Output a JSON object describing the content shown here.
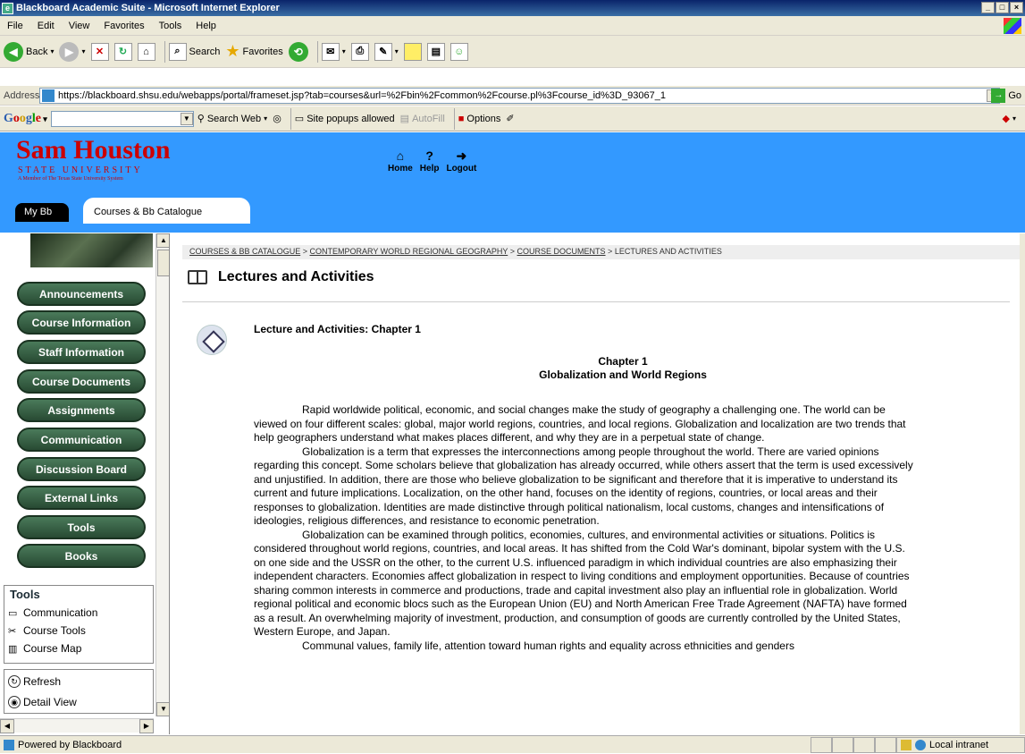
{
  "window": {
    "title": "Blackboard Academic Suite - Microsoft Internet Explorer"
  },
  "menu": [
    "File",
    "Edit",
    "View",
    "Favorites",
    "Tools",
    "Help"
  ],
  "toolbar": {
    "back": "Back",
    "search": "Search",
    "favorites": "Favorites"
  },
  "address": {
    "label": "Address",
    "url": "https://blackboard.shsu.edu/webapps/portal/frameset.jsp?tab=courses&url=%2Fbin%2Fcommon%2Fcourse.pl%3Fcourse_id%3D_93067_1",
    "go": "Go"
  },
  "google": {
    "search_web": "Search Web",
    "popups": "Site popups allowed",
    "autofill": "AutoFill",
    "options": "Options"
  },
  "header": {
    "logo_line1": "Sam Houston",
    "logo_line2": "STATE UNIVERSITY",
    "logo_line3": "A Member of The Texas State University System",
    "home": "Home",
    "help": "Help",
    "logout": "Logout"
  },
  "tabs": {
    "mybb": "My Bb",
    "courses": "Courses & Bb Catalogue"
  },
  "nav": [
    "Announcements",
    "Course Information",
    "Staff Information",
    "Course Documents",
    "Assignments",
    "Communication",
    "Discussion Board",
    "External Links",
    "Tools",
    "Books"
  ],
  "tools": {
    "title": "Tools",
    "items": [
      "Communication",
      "Course Tools",
      "Course Map"
    ]
  },
  "view": {
    "refresh": "Refresh",
    "detail": "Detail View"
  },
  "breadcrumb": {
    "c1": "COURSES & BB CATALOGUE",
    "c2": "CONTEMPORARY WORLD REGIONAL GEOGRAPHY",
    "c3": "COURSE DOCUMENTS",
    "c4": "LECTURES AND ACTIVITIES",
    "sep": ">"
  },
  "page": {
    "title": "Lectures and Activities",
    "item_title": "Lecture and Activities: Chapter 1",
    "chapter": "Chapter 1",
    "chapter_sub": "Globalization and World Regions",
    "p1": "Rapid worldwide political, economic, and social changes make the study of geography a challenging one. The world can be viewed on four different scales: global, major world regions, countries, and local regions. Globalization and localization are two trends that help geographers understand what makes places different, and why they are in a perpetual state of change.",
    "p2": "Globalization is a term that expresses the interconnections among people throughout the world. There are varied opinions regarding this concept. Some scholars believe that globalization has already occurred, while others assert that the term is used excessively and unjustified. In addition, there are those who believe globalization to be significant and therefore that it is imperative to understand its current and future implications. Localization, on the other hand, focuses on the identity of regions, countries, or local areas and their responses to globalization. Identities are made distinctive through political nationalism, local customs, changes and intensifications of ideologies, religious differences, and resistance to economic penetration.",
    "p3": "Globalization can be examined through politics, economies, cultures, and environmental activities or situations. Politics is considered throughout world regions, countries, and local areas. It has shifted from the Cold War's dominant, bipolar system with the U.S. on one side and the USSR on the other, to the current U.S. influenced paradigm in which individual countries are also emphasizing their independent characters. Economies affect globalization in respect to living conditions and employment opportunities. Because of countries sharing common interests in commerce and productions, trade and capital investment also play an influential role in globalization. World regional political and economic blocs such as the European Union (EU) and North American Free Trade Agreement (NAFTA) have formed as a result. An overwhelming majority of investment, production, and consumption of goods are currently controlled by the United States, Western Europe, and Japan.",
    "p4": "Communal values, family life, attention toward human rights and equality across ethnicities and genders"
  },
  "status": {
    "left": "Powered by Blackboard",
    "zone": "Local intranet"
  }
}
